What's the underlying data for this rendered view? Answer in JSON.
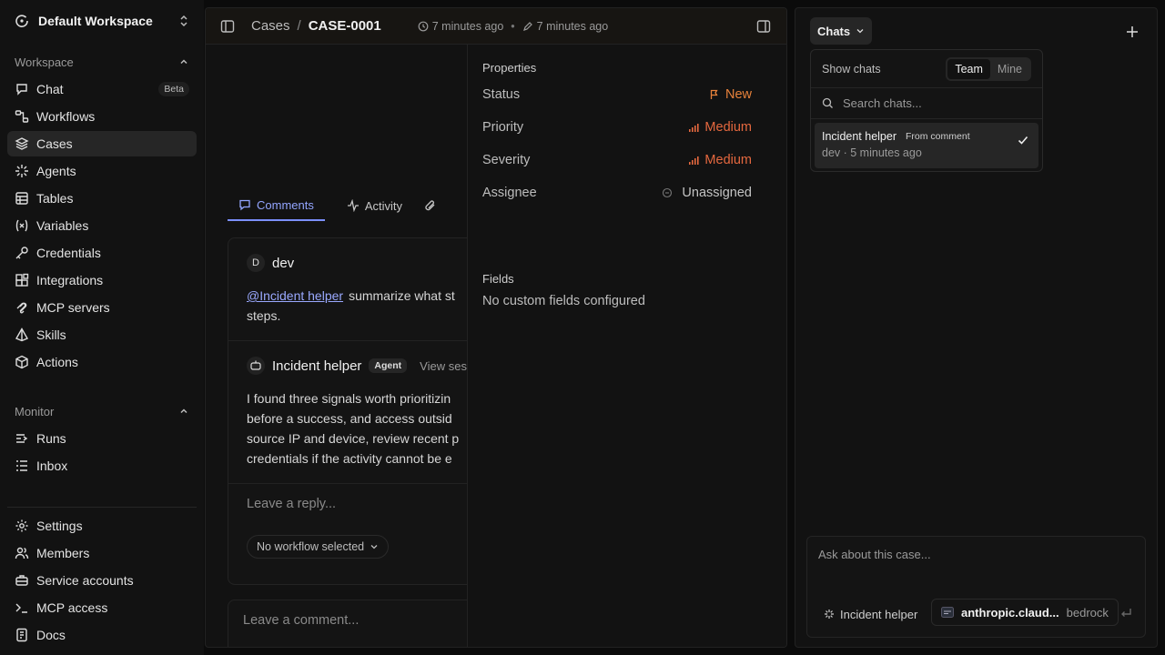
{
  "workspace": {
    "name": "Default Workspace"
  },
  "sidebar": {
    "section_workspace": "Workspace",
    "items": [
      {
        "label": "Chat",
        "icon": "chat-icon",
        "badge": "Beta"
      },
      {
        "label": "Workflows",
        "icon": "workflow-icon"
      },
      {
        "label": "Cases",
        "icon": "layers-icon",
        "active": true
      },
      {
        "label": "Agents",
        "icon": "sparkle-icon"
      },
      {
        "label": "Tables",
        "icon": "table-icon"
      },
      {
        "label": "Variables",
        "icon": "variable-icon"
      },
      {
        "label": "Credentials",
        "icon": "key-icon"
      },
      {
        "label": "Integrations",
        "icon": "blocks-icon"
      },
      {
        "label": "MCP servers",
        "icon": "mcp-icon"
      },
      {
        "label": "Skills",
        "icon": "pyramid-icon"
      },
      {
        "label": "Actions",
        "icon": "box-icon"
      }
    ],
    "section_monitor": "Monitor",
    "monitor_items": [
      {
        "label": "Runs",
        "icon": "runs-icon"
      },
      {
        "label": "Inbox",
        "icon": "inbox-icon"
      }
    ],
    "bottom_items": [
      {
        "label": "Settings",
        "icon": "gear-icon"
      },
      {
        "label": "Members",
        "icon": "users-icon"
      },
      {
        "label": "Service accounts",
        "icon": "briefcase-icon"
      },
      {
        "label": "MCP access",
        "icon": "terminal-icon"
      },
      {
        "label": "Docs",
        "icon": "docs-icon"
      }
    ]
  },
  "header": {
    "breadcrumb_root": "Cases",
    "separator": "/",
    "case_id": "CASE-0001",
    "created": "7 minutes ago",
    "edited": "7 minutes ago"
  },
  "tabs": [
    {
      "label": "Comments",
      "active": true
    },
    {
      "label": "Activity"
    }
  ],
  "comments": [
    {
      "author": "dev",
      "avatar": "D",
      "mention": "@Incident helper",
      "text_line1": "summarize what st",
      "text_line2": "steps."
    },
    {
      "author": "Incident helper",
      "badge": "Agent",
      "link": "View ses",
      "lines": [
        "I found three signals worth prioritizin",
        "before a success, and access outsid",
        "source IP and device, review recent p",
        "credentials if the activity cannot be e"
      ]
    }
  ],
  "reply_placeholder": "Leave a reply...",
  "workflow_selector": "No workflow selected",
  "comment_placeholder": "Leave a comment...",
  "properties": {
    "title": "Properties",
    "rows": [
      {
        "key": "Status",
        "value": "New",
        "color": "#e8823b"
      },
      {
        "key": "Priority",
        "value": "Medium",
        "color": "#e5683f"
      },
      {
        "key": "Severity",
        "value": "Medium",
        "color": "#e5683f"
      },
      {
        "key": "Assignee",
        "value": "Unassigned",
        "color": "#c4c4c4"
      }
    ],
    "fields_title": "Fields",
    "fields_empty": "No custom fields configured"
  },
  "chat_panel": {
    "chats_label": "Chats",
    "show_chats": "Show chats",
    "toggle": [
      "Team",
      "Mine"
    ],
    "search_placeholder": "Search chats...",
    "item": {
      "title": "Incident helper",
      "source": "From comment",
      "subtitle": "dev · 5 minutes ago"
    },
    "composer_placeholder": "Ask about this case...",
    "agent": "Incident helper",
    "model": "anthropic.claud...",
    "provider": "bedrock"
  }
}
